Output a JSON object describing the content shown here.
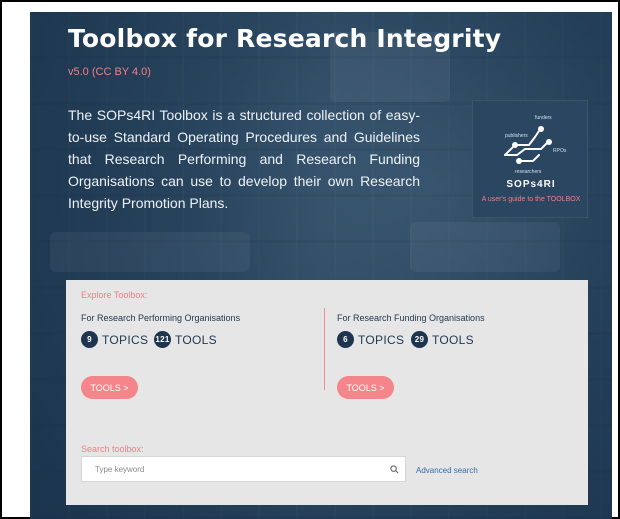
{
  "hero": {
    "title": "Toolbox for Research Integrity",
    "version": "v5.0 (CC BY 4.0)",
    "intro": "The SOPs4RI Toolbox is a structured collection of easy-to-use Standard Operating Procedures and Guidelines that Research Performing and Research Funding Organisations can use to develop their own Research Integrity Promotion Plans."
  },
  "logo": {
    "name": "SOPs4RI",
    "tagline": "A user's guide to the TOOLBOX",
    "node_labels": [
      "funders",
      "publishers",
      "RPOs",
      "researchers"
    ]
  },
  "explore": {
    "label": "Explore Toolbox:",
    "performing": {
      "title": "For Research Performing Organisations",
      "topics_count": "9",
      "topics_label": "TOPICS",
      "tools_count": "121",
      "tools_label": "TOOLS",
      "button": "TOOLS >"
    },
    "funding": {
      "title": "For Research Funding Organisations",
      "topics_count": "6",
      "topics_label": "TOPICS",
      "tools_count": "29",
      "tools_label": "TOOLS",
      "button": "TOOLS >"
    }
  },
  "search": {
    "label": "Search toolbox:",
    "placeholder": "Type keyword",
    "advanced": "Advanced search"
  },
  "colors": {
    "accent": "#f4858b",
    "navy": "#1e3550",
    "panel": "#e6e6e6"
  },
  "icons": {
    "search": "search-icon",
    "logo_graph": "network-graph-icon"
  }
}
